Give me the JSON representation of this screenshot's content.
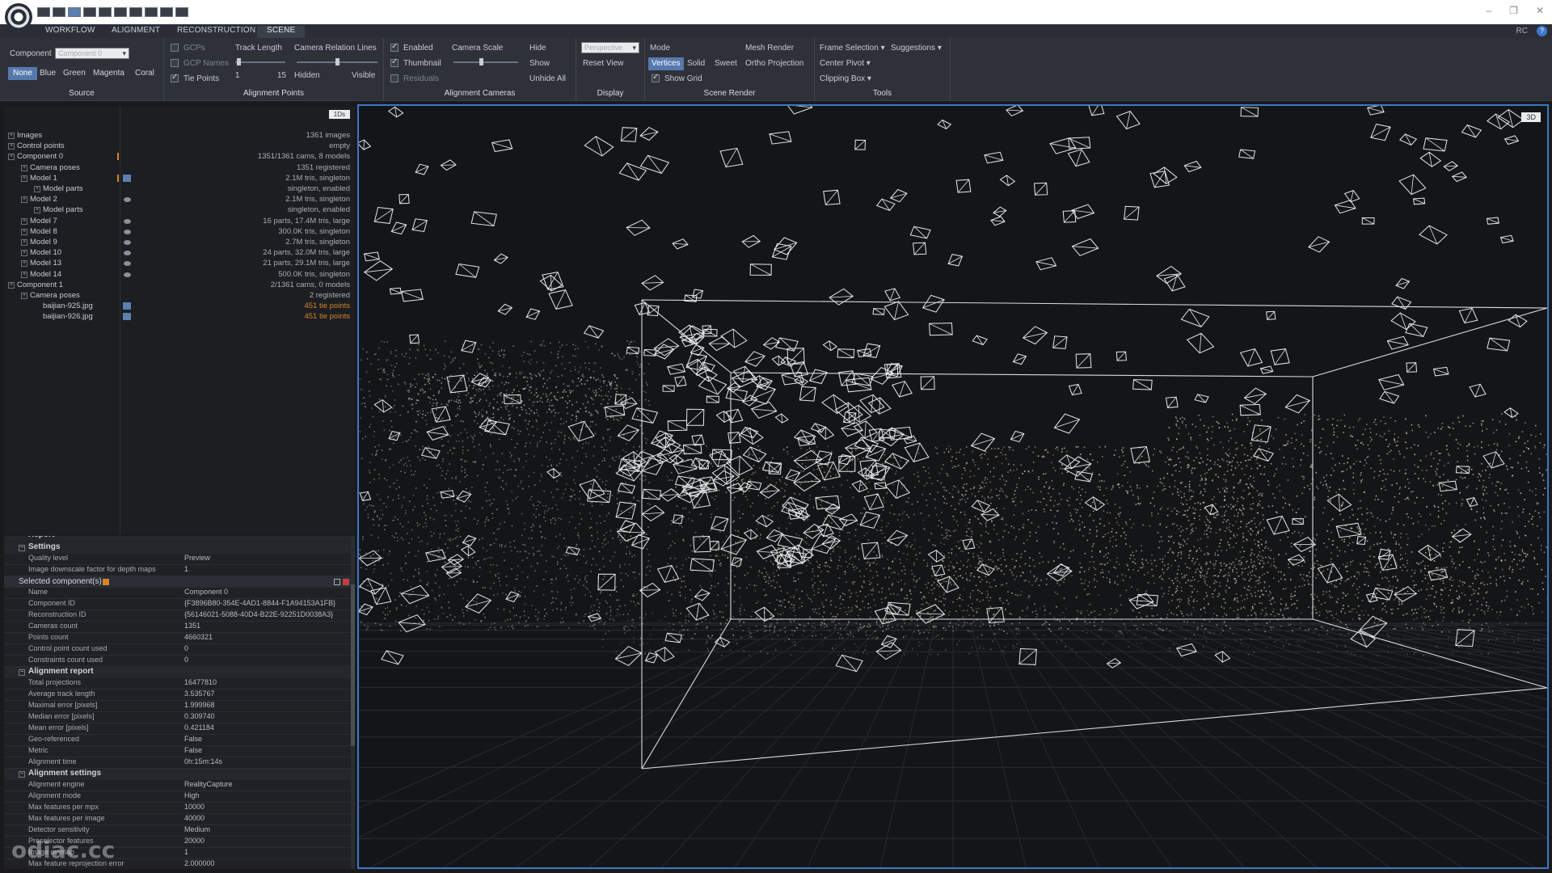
{
  "app": {
    "tabs": [
      "WORKFLOW",
      "ALIGNMENT",
      "RECONSTRUCTION",
      "SCENE"
    ],
    "active_tab": "SCENE",
    "rc_label": "RC",
    "help": "?"
  },
  "ribbon": {
    "source": {
      "title": "Source",
      "component_label": "Component",
      "component_value": "Component 0",
      "colors": [
        "None",
        "Blue",
        "Green",
        "Magenta",
        "Coral"
      ]
    },
    "alignment_points": {
      "title": "Alignment Points",
      "gcps": "GCPs",
      "gcp_names": "GCP Names",
      "tie_points": "Tie Points",
      "track_length": "Track Length",
      "track_min": "1",
      "track_max": "15",
      "camera_relation_lines": "Camera Relation Lines",
      "hidden": "Hidden",
      "visible": "Visible"
    },
    "alignment_cameras": {
      "title": "Alignment Cameras",
      "enabled": "Enabled",
      "thumbnail": "Thumbnail",
      "residuals": "Residuals",
      "camera_scale": "Camera Scale",
      "hide": "Hide",
      "show": "Show",
      "unhide_all": "Unhide All"
    },
    "display": {
      "title": "Display",
      "projection": "Perspective",
      "reset_view": "Reset View"
    },
    "scene_render": {
      "title": "Scene Render",
      "mode": "Mode",
      "mesh_render": "Mesh Render",
      "vertices": "Vertices",
      "solid": "Solid",
      "sweet": "Sweet",
      "ortho_projection": "Ortho Projection",
      "show_grid": "Show Grid"
    },
    "tools": {
      "title": "Tools",
      "frame_selection": "Frame Selection",
      "suggestions": "Suggestions",
      "center_pivot": "Center Pivot",
      "clipping_box": "Clipping Box"
    }
  },
  "tree": {
    "badge": "1Ds",
    "rows": [
      {
        "name": "Images",
        "value": "1361 images"
      },
      {
        "name": "Control points",
        "value": "empty"
      },
      {
        "name": "Component 0",
        "value": "1351/1361 cams, 8 models"
      },
      {
        "name": "Camera poses",
        "value": "1351 registered"
      },
      {
        "name": "Model 1",
        "value": "2.1M tris, singleton"
      },
      {
        "name": "Model parts",
        "value": "singleton, enabled"
      },
      {
        "name": "Model 2",
        "value": "2.1M tris, singleton"
      },
      {
        "name": "Model parts",
        "value": "singleton, enabled"
      },
      {
        "name": "Model 7",
        "value": "16 parts, 17.4M tris, large"
      },
      {
        "name": "Model 8",
        "value": "300.0K tris, singleton"
      },
      {
        "name": "Model 9",
        "value": "2.7M tris, singleton"
      },
      {
        "name": "Model 10",
        "value": "24 parts, 32.0M tris, large"
      },
      {
        "name": "Model 13",
        "value": "21 parts, 29.1M tris, large"
      },
      {
        "name": "Model 14",
        "value": "500.0K tris, singleton"
      },
      {
        "name": "Component 1",
        "value": "2/1361 cams, 0 models"
      },
      {
        "name": "Camera poses",
        "value": "2 registered"
      },
      {
        "name": "baijian-925.jpg",
        "value": "451 tie points"
      },
      {
        "name": "baijian-926.jpg",
        "value": "451 tie points"
      }
    ]
  },
  "props": {
    "report_label": "Report",
    "settings_header": "Settings",
    "settings": [
      {
        "key": "Quality level",
        "value": "Preview"
      },
      {
        "key": "Image downscale factor for depth maps",
        "value": "1"
      }
    ],
    "selected_header": "Selected component(s)",
    "selected": [
      {
        "key": "Name",
        "value": "Component 0"
      },
      {
        "key": "Component ID",
        "value": "{F3896B80-354E-4AD1-8844-F1A94153A1FB}"
      },
      {
        "key": "Reconstruction ID",
        "value": "{56146021-5088-40D4-B22E-92251D0038A3}"
      },
      {
        "key": "Cameras count",
        "value": "1351"
      },
      {
        "key": "Points count",
        "value": "4660321"
      },
      {
        "key": "Control point count used",
        "value": "0"
      },
      {
        "key": "Constraints count used",
        "value": "0"
      }
    ],
    "alignment_report_header": "Alignment report",
    "alignment_report": [
      {
        "key": "Total projections",
        "value": "16477810"
      },
      {
        "key": "Average track length",
        "value": "3.535767"
      },
      {
        "key": "Maximal error [pixels]",
        "value": "1.999968"
      },
      {
        "key": "Median error [pixels]",
        "value": "0.309740"
      },
      {
        "key": "Mean error [pixels]",
        "value": "0.421184"
      },
      {
        "key": "Geo-referenced",
        "value": "False"
      },
      {
        "key": "Metric",
        "value": "False"
      },
      {
        "key": "Alignment time",
        "value": "0h:15m:14s"
      }
    ],
    "alignment_settings_header": "Alignment settings",
    "alignment_settings": [
      {
        "key": "Alignment engine",
        "value": "RealityCapture"
      },
      {
        "key": "Alignment mode",
        "value": "High"
      },
      {
        "key": "Max features per mpx",
        "value": "10000"
      },
      {
        "key": "Max features per image",
        "value": "40000"
      },
      {
        "key": "Detector sensitivity",
        "value": "Medium"
      },
      {
        "key": "Preselector features",
        "value": "20000"
      },
      {
        "key": "Image overlap",
        "value": "1"
      },
      {
        "key": "Max feature reprojection error",
        "value": "2.000000"
      }
    ]
  },
  "viewport": {
    "badge": "3D"
  },
  "watermark": "odiac.cc",
  "colors": {
    "accent": "#3d78c8",
    "selected": "#5579ad",
    "orange": "#d7832c"
  }
}
